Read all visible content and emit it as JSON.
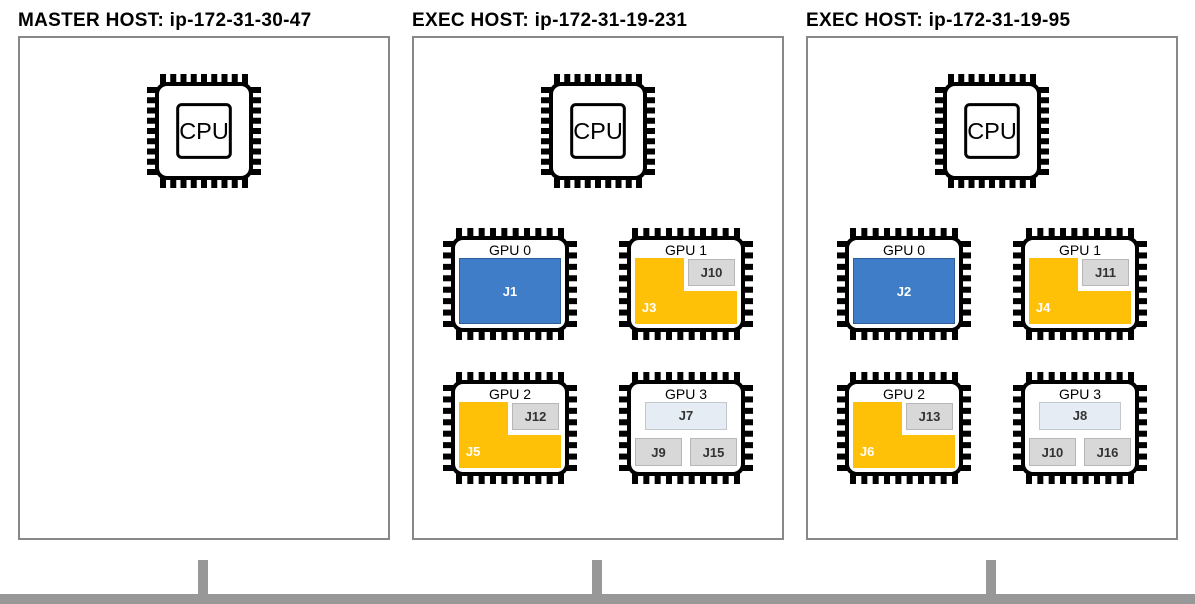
{
  "hosts": [
    {
      "title": "MASTER HOST: ip-172-31-30-47",
      "cpu_label": "CPU",
      "gpus": []
    },
    {
      "title": "EXEC HOST: ip-172-31-19-231",
      "cpu_label": "CPU",
      "gpus": [
        {
          "label": "GPU 0",
          "layout": "full-blue",
          "jobs": {
            "main": "J1"
          }
        },
        {
          "label": "GPU 1",
          "layout": "L-orange-grey",
          "jobs": {
            "main": "J3",
            "small": "J10"
          }
        },
        {
          "label": "GPU 2",
          "layout": "L-orange-grey",
          "jobs": {
            "main": "J5",
            "small": "J12"
          }
        },
        {
          "label": "GPU 3",
          "layout": "pale-three",
          "jobs": {
            "top": "J7",
            "bl": "J9",
            "br": "J15"
          }
        }
      ]
    },
    {
      "title": "EXEC HOST: ip-172-31-19-95",
      "cpu_label": "CPU",
      "gpus": [
        {
          "label": "GPU 0",
          "layout": "full-blue",
          "jobs": {
            "main": "J2"
          }
        },
        {
          "label": "GPU 1",
          "layout": "L-orange-grey",
          "jobs": {
            "main": "J4",
            "small": "J11"
          }
        },
        {
          "label": "GPU 2",
          "layout": "L-orange-grey",
          "jobs": {
            "main": "J6",
            "small": "J13"
          }
        },
        {
          "label": "GPU 3",
          "layout": "pale-three",
          "jobs": {
            "top": "J8",
            "bl": "J10",
            "br": "J16"
          }
        }
      ]
    }
  ]
}
